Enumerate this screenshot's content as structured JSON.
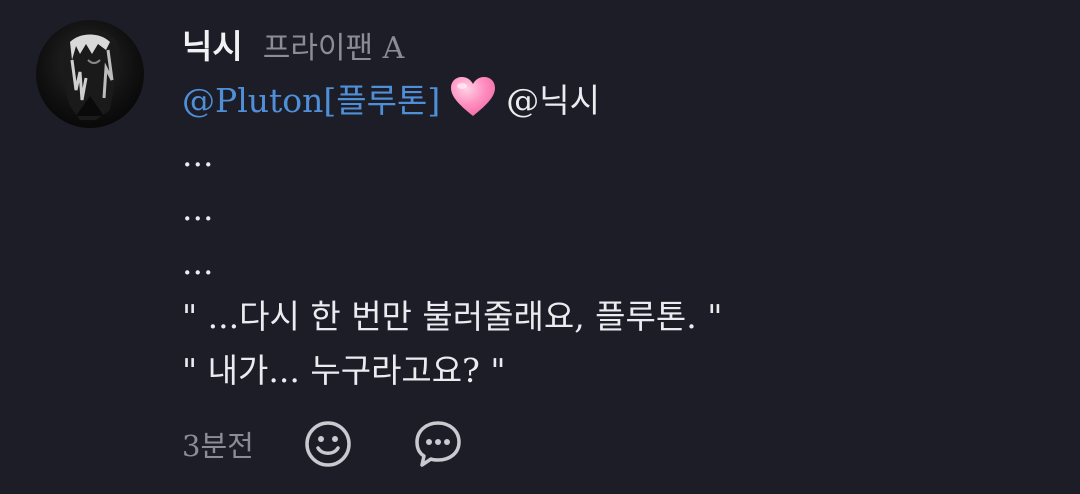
{
  "user": {
    "name": "닉시",
    "handle": "프라이팬 A"
  },
  "content": {
    "mention1": "@Pluton[플루톤]",
    "heart_icon": "pink-heart-emoji",
    "mention2": "@닉시",
    "lines": [
      "...",
      "...",
      "...",
      "\" ...다시 한 번만 불러줄래요, 플루톤. \"",
      "\" 내가... 누구라고요? \""
    ]
  },
  "footer": {
    "time": "3분전",
    "reaction_icon": "smiley-icon",
    "comment_icon": "speech-bubble-icon"
  },
  "colors": {
    "background": "#1c1d27",
    "mention": "#4f8fd8",
    "muted": "#8b8c96",
    "text": "#ececf0",
    "heart": "#ff8fbf"
  }
}
